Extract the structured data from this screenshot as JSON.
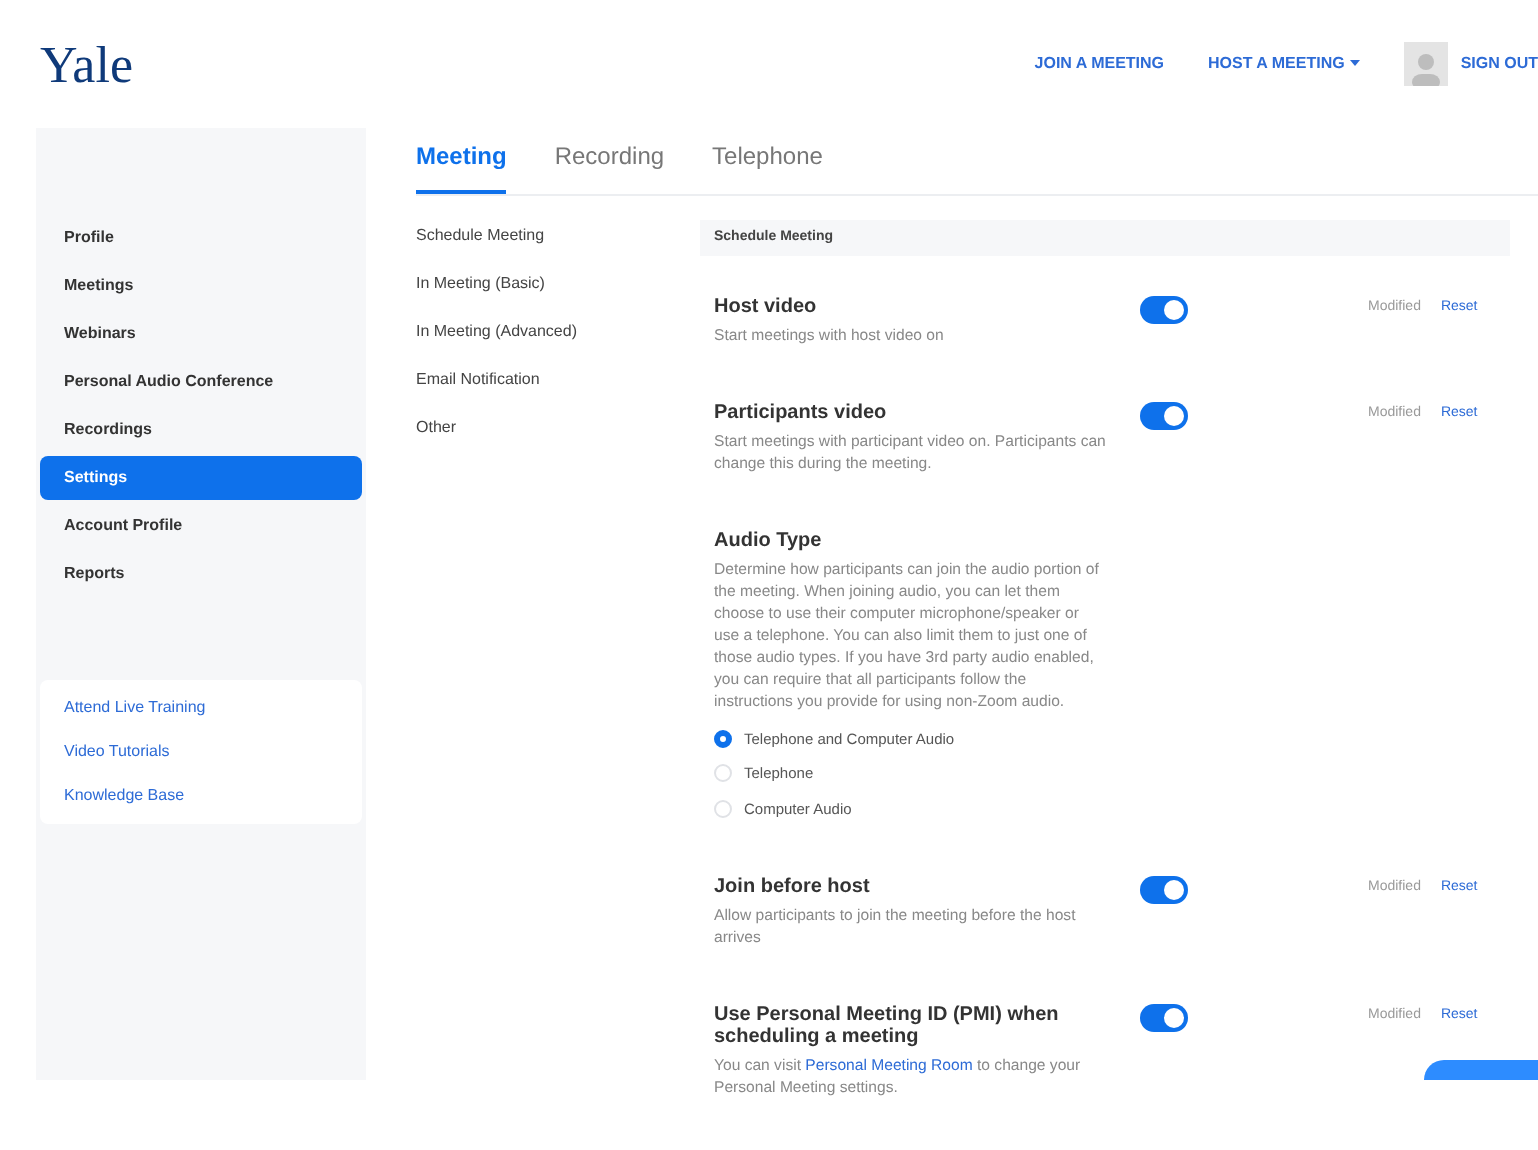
{
  "header": {
    "logo": "Yale",
    "links": [
      {
        "label": "JOIN A MEETING",
        "dropdown": false
      },
      {
        "label": "HOST A MEETING",
        "dropdown": true
      }
    ],
    "sign_out": "SIGN OUT"
  },
  "sidebar": {
    "items": [
      {
        "label": "Profile",
        "selected": false
      },
      {
        "label": "Meetings",
        "selected": false
      },
      {
        "label": "Webinars",
        "selected": false
      },
      {
        "label": "Personal Audio Conference",
        "selected": false
      },
      {
        "label": "Recordings",
        "selected": false
      },
      {
        "label": "Settings",
        "selected": true
      },
      {
        "label": "Account Profile",
        "selected": false
      },
      {
        "label": "Reports",
        "selected": false
      }
    ],
    "help_links": [
      "Attend Live Training",
      "Video Tutorials",
      "Knowledge Base"
    ]
  },
  "tabs": [
    {
      "label": "Meeting",
      "selected": true
    },
    {
      "label": "Recording",
      "selected": false
    },
    {
      "label": "Telephone",
      "selected": false
    }
  ],
  "subnav": [
    "Schedule Meeting",
    "In Meeting (Basic)",
    "In Meeting (Advanced)",
    "Email Notification",
    "Other"
  ],
  "section": {
    "title": "Schedule Meeting",
    "settings": [
      {
        "kind": "toggle",
        "title": "Host video",
        "description": "Start meetings with host video on",
        "on": true,
        "status": "Modified",
        "reset": "Reset"
      },
      {
        "kind": "toggle",
        "title": "Participants video",
        "description": "Start meetings with participant video on. Participants can change this during the meeting.",
        "on": true,
        "status": "Modified",
        "reset": "Reset"
      },
      {
        "kind": "radio",
        "title": "Audio Type",
        "description": "Determine how participants can join the audio portion of the meeting. When joining audio, you can let them choose to use their computer microphone/speaker or use a telephone. You can also limit them to just one of those audio types. If you have 3rd party audio enabled, you can require that all participants follow the instructions you provide for using non-Zoom audio.",
        "options": [
          {
            "label": "Telephone and Computer Audio",
            "selected": true
          },
          {
            "label": "Telephone",
            "selected": false
          },
          {
            "label": "Computer Audio",
            "selected": false
          }
        ]
      },
      {
        "kind": "toggle",
        "title": "Join before host",
        "description": "Allow participants to join the meeting before the host arrives",
        "on": true,
        "status": "Modified",
        "reset": "Reset"
      },
      {
        "kind": "toggle",
        "title": "Use Personal Meeting ID (PMI) when scheduling a meeting",
        "description": "You can visit",
        "link": "Personal Meeting Room",
        "description_after": "to change your Personal Meeting settings.",
        "on": true,
        "status": "Modified",
        "reset": "Reset"
      }
    ]
  }
}
